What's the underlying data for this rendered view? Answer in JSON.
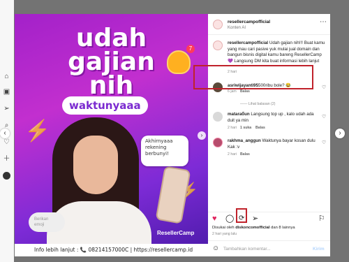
{
  "sidebar": {
    "icons": [
      "home-icon",
      "reels-icon",
      "send-icon",
      "search-icon",
      "heart-icon",
      "create-icon",
      "profile-icon"
    ]
  },
  "post": {
    "headline": [
      "udah",
      "gajian",
      "nih"
    ],
    "pill": "waktunyaaa",
    "bubble": "Akhirnyaaa rekening berbunyi!",
    "hint": "Berikan emoji",
    "logo": "ResellerCamp",
    "footer": "Info lebih lanjut :  📞 08214157000C  |  https://resellercamp.id",
    "bell_badge": "7"
  },
  "panel": {
    "username": "resellercampofficial",
    "subtitle": "Konten AI",
    "caption_user": "resellercampofficial",
    "caption": "Udah gajian nih!!! Buat kamu yang mau cari pasive yuk mulai jual domain dan bangun bisnis digital kamu bareng ResellerCamp 💜 Langsung DM kita buat informasi lebih lanjut",
    "caption_time": "2 hari",
    "comments": [
      {
        "user": "asriwijayanti95",
        "text": "500ribu bole? 😂",
        "time": "6 jam",
        "reply": "Balas"
      },
      {
        "hidden": "—— Lihat balasan (2)"
      },
      {
        "user": "mataraбun",
        "text": "Langsung top up , kalo udah ada duit ya min",
        "time": "2 hari",
        "likes": "1 suka",
        "reply": "Balas"
      },
      {
        "user": "rakhma_anggun",
        "text": "Waktunya bayar kosan dulu Kak :v",
        "time": "2 hari",
        "reply": "Balas"
      }
    ],
    "likes_text": "Disukai oleh",
    "likes_user": "diskoncomofficial",
    "likes_rest": "dan 8 lainnya",
    "post_time": "2 hari yang lalu",
    "comment_placeholder": "Tambahkan komentar...",
    "post_label": "Kirim"
  }
}
